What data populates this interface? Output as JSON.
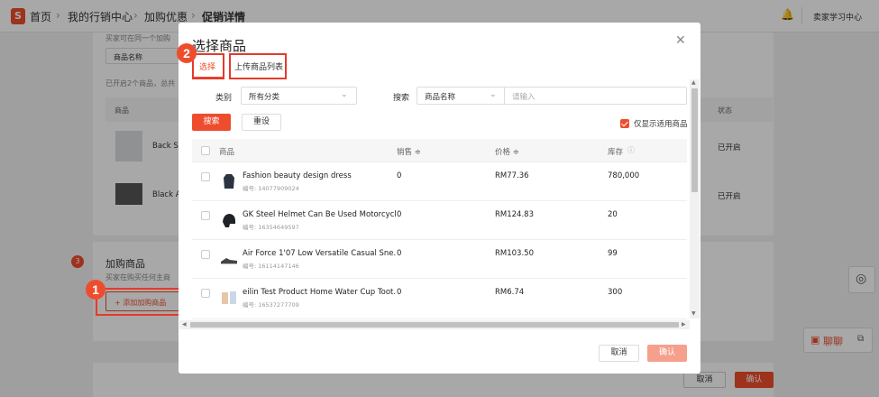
{
  "breadcrumb": {
    "home": "首页",
    "level1": "我的行销中心",
    "level2": "加购优惠",
    "current": "促销详情"
  },
  "topbar": {
    "user": "卖家学习中心"
  },
  "background": {
    "hint1": "买家可在同一个加购",
    "filter_select": "商品名称",
    "summary": "已开启2个商品，总共",
    "col_product": "商品",
    "col_status": "状态",
    "products": [
      {
        "name": "Back Sh",
        "status": "已开启"
      },
      {
        "name": "Black A",
        "status": "已开启"
      }
    ],
    "section_number": "3",
    "section_title": "加购商品",
    "section_desc": "买家在购买任何主商",
    "add_button": "+ 添加加购商品",
    "cancel": "取消",
    "confirm": "确认"
  },
  "chat": {
    "label": "聊聊"
  },
  "modal": {
    "title": "选择商品",
    "tabs": [
      {
        "label": "选择",
        "active": true
      },
      {
        "label": "上传商品列表",
        "active": false
      }
    ],
    "filters": {
      "category_label": "类别",
      "category_value": "所有分类",
      "search_label": "搜索",
      "search_field": "商品名称",
      "search_placeholder": "请输入"
    },
    "search_button": "搜索",
    "reset_button": "重设",
    "only_applicable": "仅显示适用商品",
    "columns": {
      "product": "商品",
      "sales": "销售 ≑",
      "price": "价格 ≑",
      "stock": "库存"
    },
    "rows": [
      {
        "name": "Fashion beauty design dress",
        "id": "编号: 14077909024",
        "sales": "0",
        "price": "RM77.36",
        "stock": "780,000"
      },
      {
        "name": "GK Steel Helmet Can Be Used Motorcycl...",
        "id": "编号: 16354649597",
        "sales": "0",
        "price": "RM124.83",
        "stock": "20"
      },
      {
        "name": "Air Force 1'07 Low Versatile Casual Sne...",
        "id": "编号: 16114147146",
        "sales": "0",
        "price": "RM103.50",
        "stock": "99"
      },
      {
        "name": "eilin Test Product Home Water Cup Toot...",
        "id": "编号: 16537277709",
        "sales": "0",
        "price": "RM6.74",
        "stock": "300"
      }
    ],
    "cancel": "取消",
    "confirm": "确认"
  },
  "markers": {
    "one": "1",
    "two": "2"
  },
  "colors": {
    "brand": "#ee4d2d",
    "highlight_box": "#e53a2a"
  }
}
